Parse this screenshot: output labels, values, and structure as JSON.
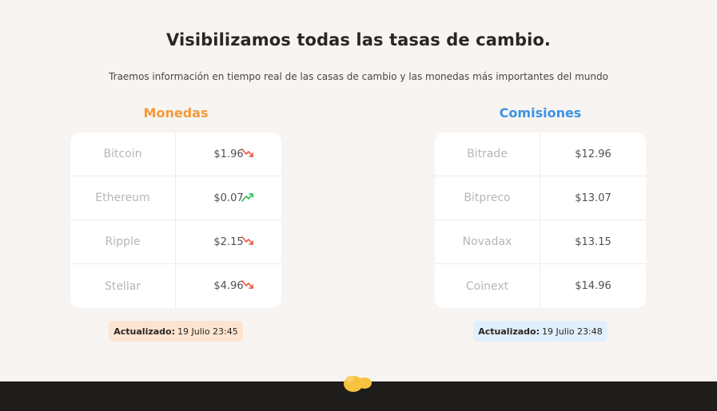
{
  "header": {
    "title": "Visibilizamos todas las tasas de cambio.",
    "subtitle": "Traemos información en tiempo real de las casas de cambio y las monedas más importantes del mundo"
  },
  "monedas": {
    "title": "Monedas",
    "accent": "#f39a3a",
    "rows": [
      {
        "name": "Bitcoin",
        "value": "$1.96",
        "trend": "down"
      },
      {
        "name": "Ethereum",
        "value": "$0.07",
        "trend": "up"
      },
      {
        "name": "Ripple",
        "value": "$2.15",
        "trend": "down"
      },
      {
        "name": "Stellar",
        "value": "$4.96",
        "trend": "down"
      }
    ],
    "updated_label": "Actualizado:",
    "updated_value": "19 Julio 23:45"
  },
  "comisiones": {
    "title": "Comisiones",
    "accent": "#3b93e6",
    "rows": [
      {
        "name": "Bitrade",
        "value": "$12.96"
      },
      {
        "name": "Bitpreco",
        "value": "$13.07"
      },
      {
        "name": "Novadax",
        "value": "$13.15"
      },
      {
        "name": "Coinext",
        "value": "$14.96"
      }
    ],
    "updated_label": "Actualizado:",
    "updated_value": "19 Julio 23:48"
  },
  "icons": {
    "trend_down": "trend-down-icon",
    "trend_up": "trend-up-icon",
    "logo": "logo-icon"
  }
}
